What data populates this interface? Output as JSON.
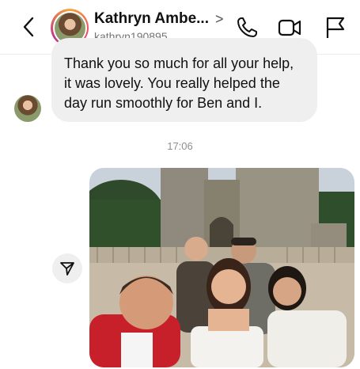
{
  "header": {
    "display_name": "Kathryn Ambe...",
    "chevron": ">",
    "username": "kathryn190895"
  },
  "thread": {
    "message_text": "Thank you so much for all your help, it was lovely. You really helped the day run smoothly for Ben and I.",
    "timestamp": "17:06"
  },
  "icons": {
    "back": "back-chevron-icon",
    "call": "phone-icon",
    "video": "video-camera-icon",
    "report": "flag-icon",
    "share": "send-icon"
  },
  "colors": {
    "bubble": "#efefef",
    "story_ring_start": "#f9a53b",
    "story_ring_end": "#c13584",
    "timestamp": "#8e8e8e"
  }
}
